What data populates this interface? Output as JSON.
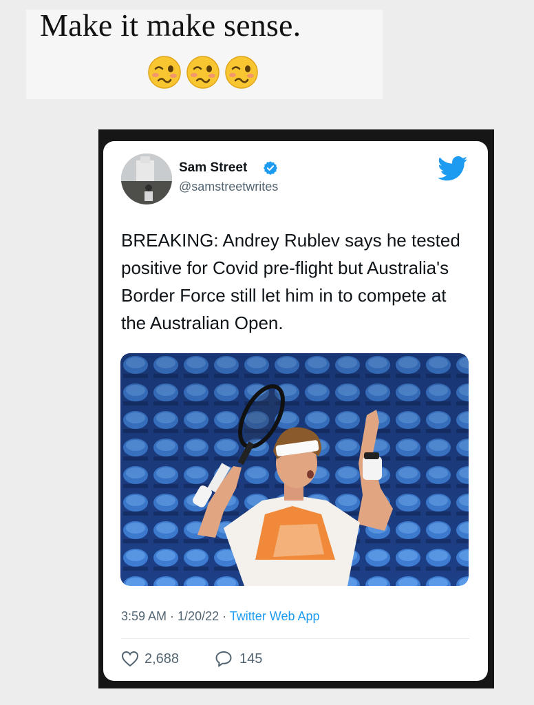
{
  "story": {
    "caption": "Make it make sense.",
    "emojis": [
      "woozy-face-icon",
      "woozy-face-icon",
      "woozy-face-icon"
    ]
  },
  "tweet": {
    "author_name": "Sam Street",
    "verified": true,
    "handle": "@samstreetwrites",
    "text": "BREAKING: Andrey Rublev says he tested positive for Covid pre-flight but Australia's Border Force still let him in to compete at the Australian Open.",
    "photo": "tennis player in orange and white shirt with headband raising racket in front of empty blue stadium seats",
    "time": "3:59 AM",
    "date": "1/20/22",
    "source": "Twitter Web App",
    "likes": "2,688",
    "replies": "145"
  },
  "colors": {
    "twitter_blue": "#1d9bf0",
    "page_background": "#ededed",
    "frame": "#161616",
    "emoji_yellow": "#f7c631"
  }
}
